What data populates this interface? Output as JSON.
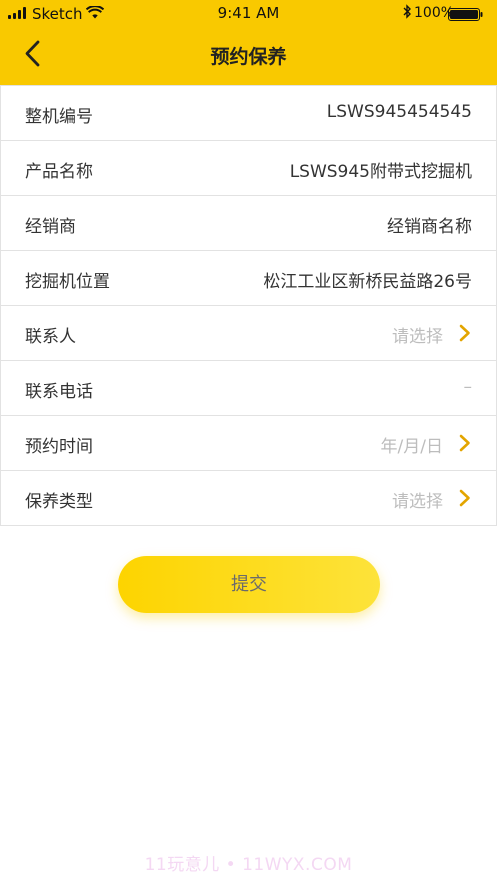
{
  "status_bar": {
    "carrier": "Sketch",
    "time": "9:41 AM",
    "battery": "100%"
  },
  "header": {
    "title": "预约保养",
    "back_icon": "chevron-left-icon"
  },
  "colors": {
    "brand": "#f9c900",
    "chevron": "#e3a500",
    "placeholder": "#bdbdbd"
  },
  "form": {
    "rows": [
      {
        "label": "整机编号",
        "value": "LSWS945454545"
      },
      {
        "label": "产品名称",
        "value": "LSWS945附带式挖掘机"
      },
      {
        "label": "经销商",
        "value": "经销商名称"
      },
      {
        "label": "挖掘机位置",
        "value": "松江工业区新桥民益路26号"
      },
      {
        "label": "联系人",
        "placeholder": "请选择",
        "icon": "chevron-right-icon"
      },
      {
        "label": "联系电话",
        "placeholder": "–"
      },
      {
        "label": "预约时间",
        "placeholder": "年/月/日",
        "icon": "chevron-right-icon"
      },
      {
        "label": "保养类型",
        "placeholder": "请选择",
        "icon": "chevron-right-icon"
      }
    ]
  },
  "submit": {
    "label": "提交"
  },
  "watermark": "11玩意儿 • 11WYX.COM"
}
